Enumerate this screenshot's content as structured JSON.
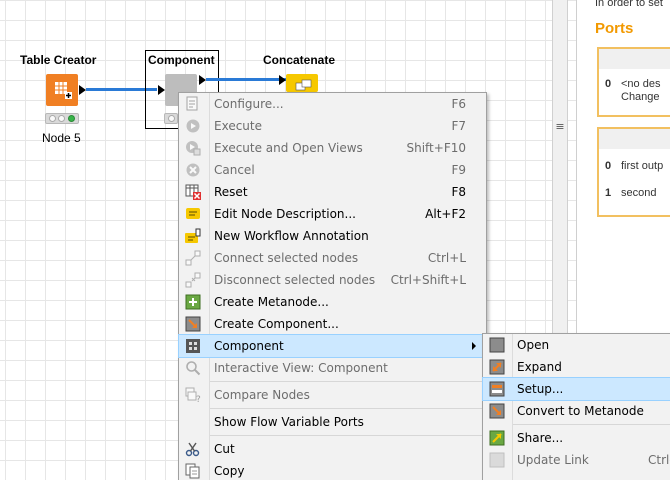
{
  "workflow": {
    "nodes": [
      {
        "title": "Table Creator",
        "label": "Node 5"
      },
      {
        "title": "Component",
        "label": ""
      },
      {
        "title": "Concatenate",
        "label": ""
      }
    ]
  },
  "description_panel": {
    "intro": "In order to set",
    "ports_heading": "Ports",
    "input_ports": [
      {
        "index": "0",
        "text": "<no des\nChange"
      }
    ],
    "output_ports": [
      {
        "index": "0",
        "text": "first outp"
      },
      {
        "index": "1",
        "text": "second"
      }
    ],
    "colors": {
      "heading": "#f29900",
      "card_border": "#f2c060"
    }
  },
  "context_menu": {
    "items": [
      {
        "label": "Configure...",
        "shortcut": "F6",
        "icon": "configure-icon",
        "disabled": true
      },
      {
        "label": "Execute",
        "shortcut": "F7",
        "icon": "execute-icon",
        "disabled": true
      },
      {
        "label": "Execute and Open Views",
        "shortcut": "Shift+F10",
        "icon": "execute-open-views-icon",
        "disabled": true
      },
      {
        "label": "Cancel",
        "shortcut": "F9",
        "icon": "cancel-icon",
        "disabled": true
      },
      {
        "label": "Reset",
        "shortcut": "F8",
        "icon": "reset-icon",
        "disabled": false
      },
      {
        "label": "Edit Node Description...",
        "shortcut": "Alt+F2",
        "icon": "edit-description-icon",
        "disabled": false
      },
      {
        "label": "New Workflow Annotation",
        "shortcut": "",
        "icon": "annotation-icon",
        "disabled": false
      },
      {
        "label": "Connect selected nodes",
        "shortcut": "Ctrl+L",
        "icon": "connect-nodes-icon",
        "disabled": true
      },
      {
        "label": "Disconnect selected nodes",
        "shortcut": "Ctrl+Shift+L",
        "icon": "disconnect-nodes-icon",
        "disabled": true
      },
      {
        "label": "Create Metanode...",
        "shortcut": "",
        "icon": "create-metanode-icon",
        "disabled": false
      },
      {
        "label": "Create Component...",
        "shortcut": "",
        "icon": "create-component-icon",
        "disabled": false
      },
      {
        "label": "Component",
        "shortcut": "",
        "icon": "component-icon",
        "disabled": false
      },
      {
        "label": "Interactive View: Component",
        "shortcut": "",
        "icon": "magnifier-icon",
        "disabled": true
      },
      {
        "label": "Compare Nodes",
        "shortcut": "",
        "icon": "compare-nodes-icon",
        "disabled": true
      },
      {
        "label": "Show Flow Variable Ports",
        "shortcut": "",
        "icon": "",
        "disabled": false
      },
      {
        "label": "Cut",
        "shortcut": "",
        "icon": "scissors-icon",
        "disabled": false
      },
      {
        "label": "Copy",
        "shortcut": "",
        "icon": "copy-icon",
        "disabled": false
      }
    ]
  },
  "submenu": {
    "items": [
      {
        "label": "Open",
        "shortcut": "",
        "icon": "open-icon",
        "disabled": false
      },
      {
        "label": "Expand",
        "shortcut": "",
        "icon": "expand-icon",
        "disabled": false
      },
      {
        "label": "Setup...",
        "shortcut": "",
        "icon": "setup-icon",
        "disabled": false
      },
      {
        "label": "Convert to Metanode",
        "shortcut": "",
        "icon": "convert-metanode-icon",
        "disabled": false
      },
      {
        "label": "Share...",
        "shortcut": "",
        "icon": "share-icon",
        "disabled": false
      },
      {
        "label": "Update Link",
        "shortcut": "Ctrl-",
        "icon": "update-link-icon",
        "disabled": true
      }
    ]
  },
  "colors": {
    "connection": "#2a7ad6",
    "table_creator_node": "#f07f23",
    "component_node": "#bdbdbd",
    "concatenate_node": "#f6c800",
    "menu_highlight": "#cce8ff"
  }
}
